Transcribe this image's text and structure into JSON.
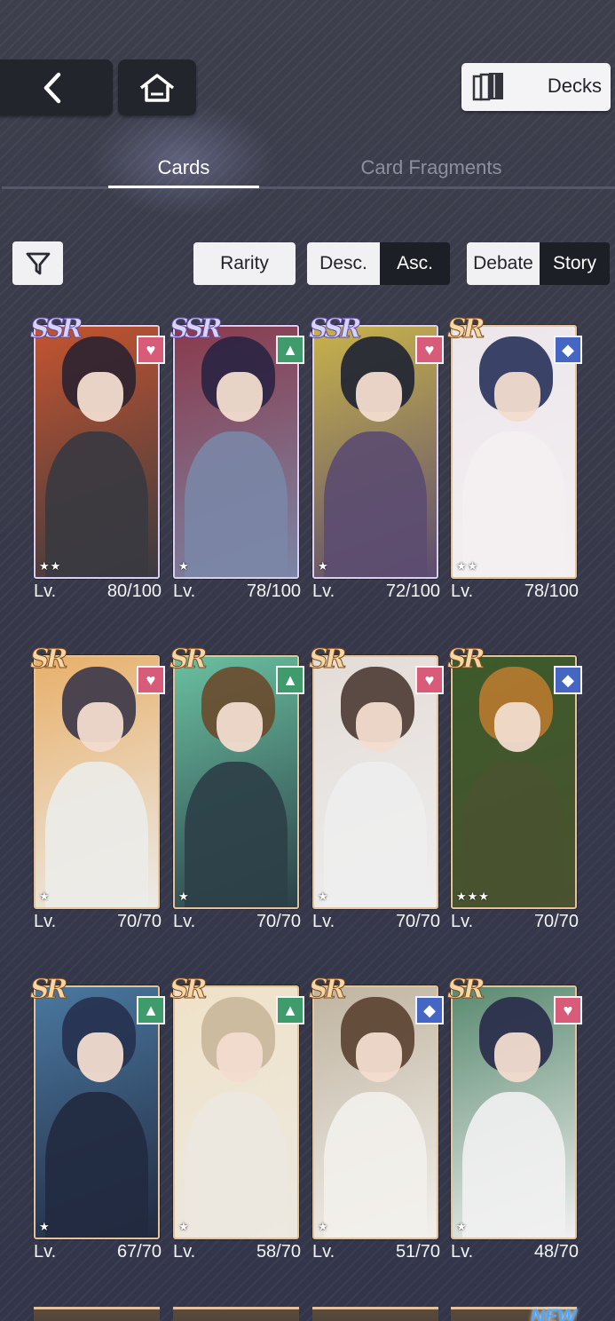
{
  "decks": {
    "label": "Decks"
  },
  "tabs": [
    {
      "label": "Cards",
      "active": true
    },
    {
      "label": "Card Fragments",
      "active": false
    }
  ],
  "sort": {
    "rarity": "Rarity",
    "desc": "Desc.",
    "asc": "Asc.",
    "debate": "Debate",
    "story": "Story"
  },
  "lv_label": "Lv.",
  "cards": [
    {
      "rarity": "SSR",
      "attribute": "heart",
      "attr_glyph": "♥",
      "stars": "★★",
      "level": "80/100",
      "colors": [
        "#2b2230",
        "#c4542f",
        "#3a3a40"
      ]
    },
    {
      "rarity": "SSR",
      "attribute": "triangle",
      "attr_glyph": "▲",
      "stars": "★",
      "level": "78/100",
      "colors": [
        "#2a2344",
        "#8a3a4c",
        "#7b86a6"
      ]
    },
    {
      "rarity": "SSR",
      "attribute": "heart",
      "attr_glyph": "♥",
      "stars": "★",
      "level": "72/100",
      "colors": [
        "#1e2233",
        "#c8b34a",
        "#5c4c70"
      ]
    },
    {
      "rarity": "SR",
      "attribute": "diamond",
      "attr_glyph": "◆",
      "stars": "★★",
      "level": "78/100",
      "colors": [
        "#26305a",
        "#ece6ea",
        "#f4f0f2"
      ]
    },
    {
      "rarity": "SR",
      "attribute": "heart",
      "attr_glyph": "♥",
      "stars": "★",
      "level": "70/70",
      "colors": [
        "#3a3648",
        "#e8b06a",
        "#ecebe8"
      ]
    },
    {
      "rarity": "SR",
      "attribute": "triangle",
      "attr_glyph": "▲",
      "stars": "★",
      "level": "70/70",
      "colors": [
        "#6a4a2e",
        "#6ac0a0",
        "#2c4048"
      ]
    },
    {
      "rarity": "SR",
      "attribute": "heart",
      "attr_glyph": "♥",
      "stars": "★",
      "level": "70/70",
      "colors": [
        "#4a3a32",
        "#e4dcd6",
        "#eeeeee"
      ]
    },
    {
      "rarity": "SR",
      "attribute": "diamond",
      "attr_glyph": "◆",
      "stars": "★★★",
      "level": "70/70",
      "colors": [
        "#b87a30",
        "#3c5a2a",
        "#4a5230"
      ]
    },
    {
      "rarity": "SR",
      "attribute": "triangle",
      "attr_glyph": "▲",
      "stars": "★",
      "level": "67/70",
      "colors": [
        "#26304e",
        "#4a78a0",
        "#222a40"
      ]
    },
    {
      "rarity": "SR",
      "attribute": "triangle",
      "attr_glyph": "▲",
      "stars": "★",
      "level": "58/70",
      "colors": [
        "#c8b69a",
        "#f0e2c8",
        "#ece8e0"
      ]
    },
    {
      "rarity": "SR",
      "attribute": "diamond",
      "attr_glyph": "◆",
      "stars": "★",
      "level": "51/70",
      "colors": [
        "#5a4030",
        "#c0b4a0",
        "#f2f0ec"
      ]
    },
    {
      "rarity": "SR",
      "attribute": "heart",
      "attr_glyph": "♥",
      "stars": "★",
      "level": "48/70",
      "colors": [
        "#282a48",
        "#5a8a70",
        "#f0f0f0"
      ]
    }
  ],
  "peek_badge": "NEW"
}
